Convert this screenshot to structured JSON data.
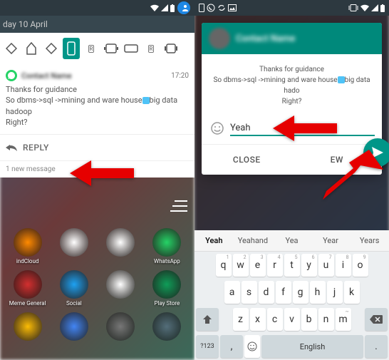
{
  "left": {
    "date": "day 10 April",
    "notification": {
      "contact": "Contact Name",
      "time": "17:20",
      "line1": "Thanks for guidance",
      "line2_a": "So dbms->sql ->mining and ware house",
      "line2_b": "big data hadoop",
      "line3": "Right?"
    },
    "reply_label": "REPLY",
    "new_msg": "1 new message",
    "apps": [
      {
        "name": "indCloud",
        "color": "#ff8a00"
      },
      {
        "name": "",
        "color": "#fff"
      },
      {
        "name": "",
        "color": "#fff"
      },
      {
        "name": "WhatsApp",
        "color": "#25d366"
      },
      {
        "name": "Meme General",
        "color": "#d32f2f"
      },
      {
        "name": "Social",
        "color": "#1da1f2"
      },
      {
        "name": "",
        "color": "#fff"
      },
      {
        "name": "Play Store",
        "color": "#0f9d58"
      },
      {
        "name": "",
        "color": "#fbbc05"
      },
      {
        "name": "",
        "color": "#4285f4"
      },
      {
        "name": "",
        "color": "#777"
      },
      {
        "name": "",
        "color": "#546e7a"
      }
    ]
  },
  "right": {
    "dialog": {
      "contact": "Contact Name",
      "body_line1": "Thanks for guidance",
      "body_line2_a": "So dbms->sql ->mining and ware house",
      "body_line2_b": "big data hado",
      "body_line3": "Right?",
      "input_value": "Yeah",
      "close_label": "CLOSE",
      "view_label": "EW"
    },
    "keyboard": {
      "suggestions": [
        "Yeah",
        "Yeahand",
        "Yea",
        "Year",
        "Years"
      ],
      "row1": [
        {
          "k": "q",
          "h": "1"
        },
        {
          "k": "w",
          "h": "2"
        },
        {
          "k": "e",
          "h": "3"
        },
        {
          "k": "r",
          "h": "4"
        },
        {
          "k": "t",
          "h": "5"
        },
        {
          "k": "y",
          "h": "6"
        },
        {
          "k": "u",
          "h": "7"
        },
        {
          "k": "i",
          "h": "8"
        },
        {
          "k": "o",
          "h": "9"
        }
      ],
      "row2": [
        {
          "k": "a"
        },
        {
          "k": "s"
        },
        {
          "k": "d"
        },
        {
          "k": "f"
        },
        {
          "k": "g"
        },
        {
          "k": "h"
        },
        {
          "k": "j"
        },
        {
          "k": "k"
        }
      ],
      "row3": [
        {
          "k": "z"
        },
        {
          "k": "x"
        },
        {
          "k": "c"
        },
        {
          "k": "v"
        },
        {
          "k": "b"
        },
        {
          "k": "n"
        },
        {
          "k": "m",
          "h": "~"
        }
      ],
      "sym_label": "?123",
      "space_label": "English"
    }
  }
}
